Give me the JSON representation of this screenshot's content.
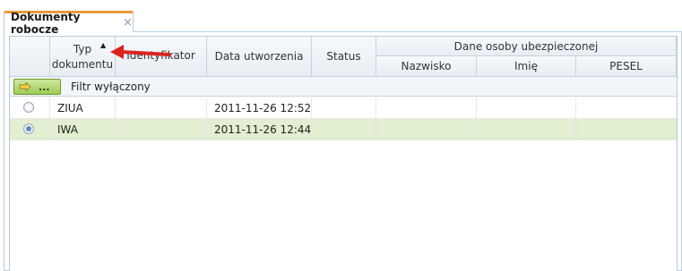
{
  "tab": {
    "title": "Dokumenty robocze",
    "close": "×"
  },
  "grid": {
    "columns": {
      "typ_line1": "Typ",
      "typ_line2": "dokumentu",
      "identyfikator": "Identyfikator",
      "data_utworzenia": "Data utworzenia",
      "status": "Status",
      "group_label": "Dane osoby ubezpieczonej",
      "nazwisko": "Nazwisko",
      "imie": "Imię",
      "pesel": "PESEL"
    },
    "filter": {
      "button_dots": "...",
      "label": "Filtr wyłączony"
    },
    "rows": [
      {
        "typ": "ZIUA",
        "identyfikator": "",
        "data": "2011-11-26 12:52",
        "status": "",
        "nazwisko": "",
        "imie": "",
        "pesel": "",
        "selected": false
      },
      {
        "typ": "IWA",
        "identyfikator": "",
        "data": "2011-11-26 12:44",
        "status": "",
        "nazwisko": "",
        "imie": "",
        "pesel": "",
        "selected": true
      }
    ]
  },
  "colors": {
    "tab_accent": "#e89a3c",
    "selected_row": "#e2efd0",
    "filter_button": "#9ccb55",
    "annotation_arrow": "#d9231f"
  },
  "icons": {
    "sort": "sort-ascending-icon",
    "filter": "filter-arrow-icon",
    "annotation": "red-arrow-icon"
  }
}
